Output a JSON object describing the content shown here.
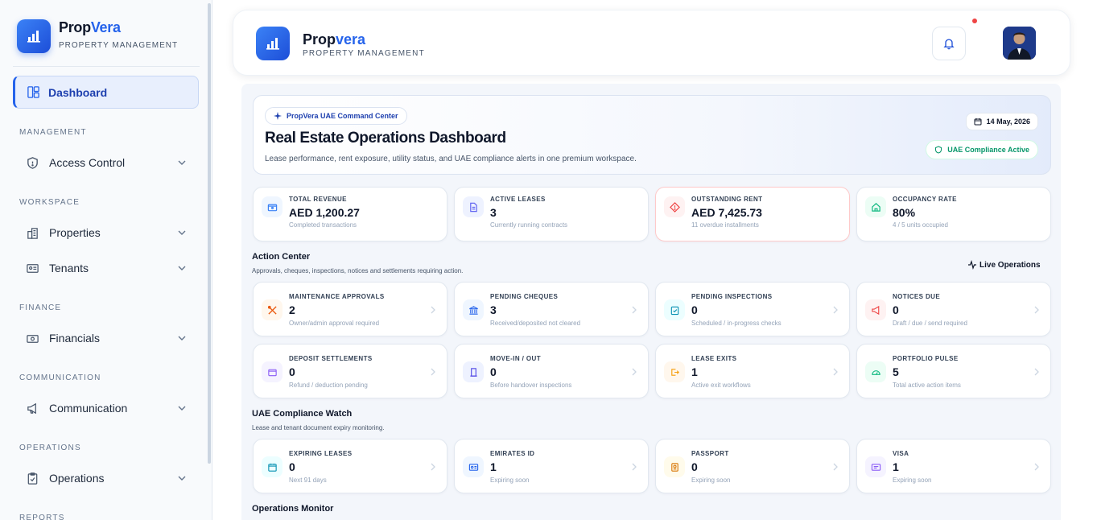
{
  "sidebar": {
    "brand_prefix": "Prop",
    "brand_accent": "Vera",
    "brand_sub": "PROPERTY MANAGEMENT",
    "active": {
      "label": "Dashboard",
      "icon": "dashboard-icon"
    },
    "sections": [
      {
        "title": "MANAGEMENT",
        "item": "Access Control",
        "icon": "shield-icon"
      },
      {
        "title": "WORKSPACE",
        "items": [
          "Properties",
          "Tenants"
        ]
      },
      {
        "title": "FINANCE",
        "item": "Financials",
        "icon": "money-icon"
      },
      {
        "title": "COMMUNICATION",
        "item": "Communication",
        "icon": "megaphone-icon"
      },
      {
        "title": "OPERATIONS",
        "item": "Operations",
        "icon": "clipboard-icon"
      },
      {
        "title": "REPORTS"
      }
    ]
  },
  "header": {
    "title_prefix": "Prop",
    "title_accent": "vera",
    "subtitle": "PROPERTY MANAGEMENT"
  },
  "hero": {
    "pill": "PropVera UAE Command Center",
    "title": "Real Estate Operations Dashboard",
    "description": "Lease performance, rent exposure, utility status, and UAE compliance alerts in one premium workspace.",
    "date": "14 May, 2026",
    "compliance": "UAE Compliance Active"
  },
  "stats": [
    {
      "label": "TOTAL REVENUE",
      "value": "AED 1,200.27",
      "sub": "Completed transactions",
      "icon": "wallet-icon",
      "color": "#3b82f6"
    },
    {
      "label": "ACTIVE LEASES",
      "value": "3",
      "sub": "Currently running contracts",
      "icon": "document-icon",
      "color": "#6366f1"
    },
    {
      "label": "OUTSTANDING RENT",
      "value": "AED 7,425.73",
      "sub": "11 overdue installments",
      "icon": "alert-icon",
      "color": "#ef4444"
    },
    {
      "label": "OCCUPANCY RATE",
      "value": "80%",
      "sub": "4 / 5 units occupied",
      "icon": "home-icon",
      "color": "#10b981"
    }
  ],
  "action_center": {
    "title": "Action Center",
    "description": "Approvals, cheques, inspections, notices and settlements requiring action.",
    "live_label": "Live Operations",
    "cards": [
      {
        "label": "MAINTENANCE APPROVALS",
        "value": "2",
        "sub": "Owner/admin approval required",
        "icon": "tools-icon"
      },
      {
        "label": "PENDING CHEQUES",
        "value": "3",
        "sub": "Received/deposited not cleared",
        "icon": "bank-icon"
      },
      {
        "label": "PENDING INSPECTIONS",
        "value": "0",
        "sub": "Scheduled / in-progress checks",
        "icon": "clipboard-check-icon"
      },
      {
        "label": "NOTICES DUE",
        "value": "0",
        "sub": "Draft / due / send required",
        "icon": "megaphone-icon"
      },
      {
        "label": "DEPOSIT SETTLEMENTS",
        "value": "0",
        "sub": "Refund / deduction pending",
        "icon": "wallet-icon"
      },
      {
        "label": "MOVE-IN / OUT",
        "value": "0",
        "sub": "Before handover inspections",
        "icon": "door-icon"
      },
      {
        "label": "LEASE EXITS",
        "value": "1",
        "sub": "Active exit workflows",
        "icon": "exit-icon"
      },
      {
        "label": "PORTFOLIO PULSE",
        "value": "5",
        "sub": "Total active action items",
        "icon": "gauge-icon"
      }
    ]
  },
  "compliance_watch": {
    "title": "UAE Compliance Watch",
    "description": "Lease and tenant document expiry monitoring.",
    "cards": [
      {
        "label": "EXPIRING LEASES",
        "value": "0",
        "sub": "Next 91 days",
        "icon": "calendar-icon"
      },
      {
        "label": "EMIRATES ID",
        "value": "1",
        "sub": "Expiring soon",
        "icon": "id-card-icon"
      },
      {
        "label": "PASSPORT",
        "value": "0",
        "sub": "Expiring soon",
        "icon": "passport-icon"
      },
      {
        "label": "VISA",
        "value": "1",
        "sub": "Expiring soon",
        "icon": "visa-icon"
      }
    ]
  },
  "operations_monitor": {
    "title": "Operations Monitor"
  }
}
